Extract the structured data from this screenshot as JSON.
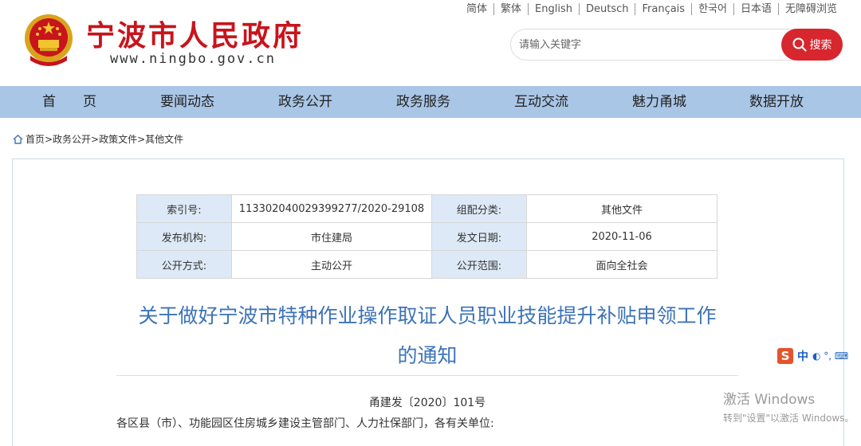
{
  "header": {
    "site_title": "宁波市人民政府",
    "site_url": "www.ningbo.gov.cn",
    "emblem_icon": "national-emblem-icon",
    "brand_color": "#c8141c"
  },
  "languages": [
    "简体",
    "繁体",
    "English",
    "Deutsch",
    "Français",
    "한국어",
    "日本语",
    "无障碍浏览"
  ],
  "search": {
    "placeholder": "请输入关键字",
    "button_label": "搜索",
    "button_color": "#d7262d"
  },
  "nav": {
    "background": "#a9c6e6",
    "items": [
      "首　　页",
      "要闻动态",
      "政务公开",
      "政务服务",
      "互动交流",
      "魅力甬城",
      "数据开放"
    ]
  },
  "breadcrumb": {
    "home_icon": "home-icon",
    "text": "首页>政务公开>政策文件>其他文件"
  },
  "info_table": {
    "index_label": "索引号:",
    "index_value": "113302040029399277/2020-29108",
    "category_label": "组配分类:",
    "category_value": "其他文件",
    "issuer_label": "发布机构:",
    "issuer_value": "市住建局",
    "date_label": "发文日期:",
    "date_value": "2020-11-06",
    "method_label": "公开方式:",
    "method_value": "主动公开",
    "scope_label": "公开范围:",
    "scope_value": "面向全社会"
  },
  "document": {
    "title_line1": "关于做好宁波市特种作业操作取证人员职业技能提升补贴申领工作",
    "title_line2": "的通知",
    "title_color": "#3d73b7",
    "number": "甬建发〔2020〕101号",
    "salutation": "各区县（市）、功能园区住房城乡建设主管部门、人力社保部门，各有关单位:"
  },
  "ime_toolbar": {
    "logo": "S",
    "mode": "中",
    "symbols": "◐ °, ⌨"
  },
  "windows_watermark": {
    "line1": "激活 Windows",
    "line2": "转到\"设置\"以激活 Windows。"
  }
}
